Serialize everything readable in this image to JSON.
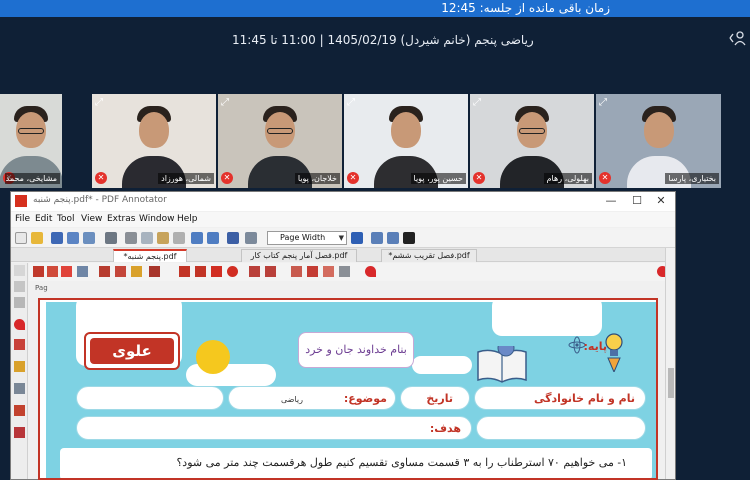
{
  "session": {
    "time_remaining": "زمان باقی مانده از جلسه: 12:45",
    "title": "ریاضی پنجم (خانم شیردل) 1405/02/19 | 11:00 تا 11:45",
    "user_icon": "user-icon",
    "chevron_icon": "chevron-left-icon"
  },
  "participants": [
    {
      "name": "مشایخی، محمد",
      "has_expand": false,
      "bg": "#d8dad7",
      "shirt": "#7d8a90",
      "glasses": true
    },
    {
      "name": "شمالی، هورزاد",
      "has_expand": true,
      "bg": "#e7e2dc",
      "shirt": "#2a2a30",
      "glasses": false
    },
    {
      "name": "خلاجان، پویا",
      "has_expand": true,
      "bg": "#c9c4bb",
      "shirt": "#2a2e33",
      "glasses": true
    },
    {
      "name": "حسین پور، پویا",
      "has_expand": true,
      "bg": "#e8ebee",
      "shirt": "#2d2d30",
      "glasses": false
    },
    {
      "name": "بهلولی، رهام",
      "has_expand": true,
      "bg": "#d6d8da",
      "shirt": "#222428",
      "glasses": true
    },
    {
      "name": "بختیاری، پارسا",
      "has_expand": true,
      "bg": "#9aa7b6",
      "shirt": "#e7e9ee",
      "glasses": false
    }
  ],
  "pdf": {
    "window_title": "پنجم شنبه.pdf* - PDF Annotator",
    "window_controls": {
      "minimize": "—",
      "maximize": "☐",
      "close": "✕"
    },
    "menu": [
      "File",
      "Edit",
      "Tool",
      "View",
      "Extras",
      "Window",
      "Help"
    ],
    "zoom": "Page Width",
    "tabs": [
      "*پنجم شنبه.pdf",
      "فصل آمار پنجم کتاب کار.pdf",
      "*فصل تقریب ششم.pdf"
    ],
    "active_tab": 0,
    "page_label": "Pag"
  },
  "worksheet": {
    "badge": "علوی",
    "basmala": "بنام خداوند جان و خرد",
    "grade_label": "پایه:",
    "name_label": "نام و نام خانوادگی",
    "date_label": "تاریخ",
    "subject_label": "موضوع:",
    "subject_value": "ریاضی",
    "goal_label": "هدف:",
    "question": "۱- می خواهیم ۷۰ استرطناب را به ۳ قسمت مساوی تقسیم کنیم طول هرقسمت چند متر می شود؟"
  },
  "colors": {
    "timer_bar": "#1e6fd0",
    "background": "#0f2036",
    "accent_red": "#c23426",
    "worksheet_blue": "#7ed2e3"
  }
}
